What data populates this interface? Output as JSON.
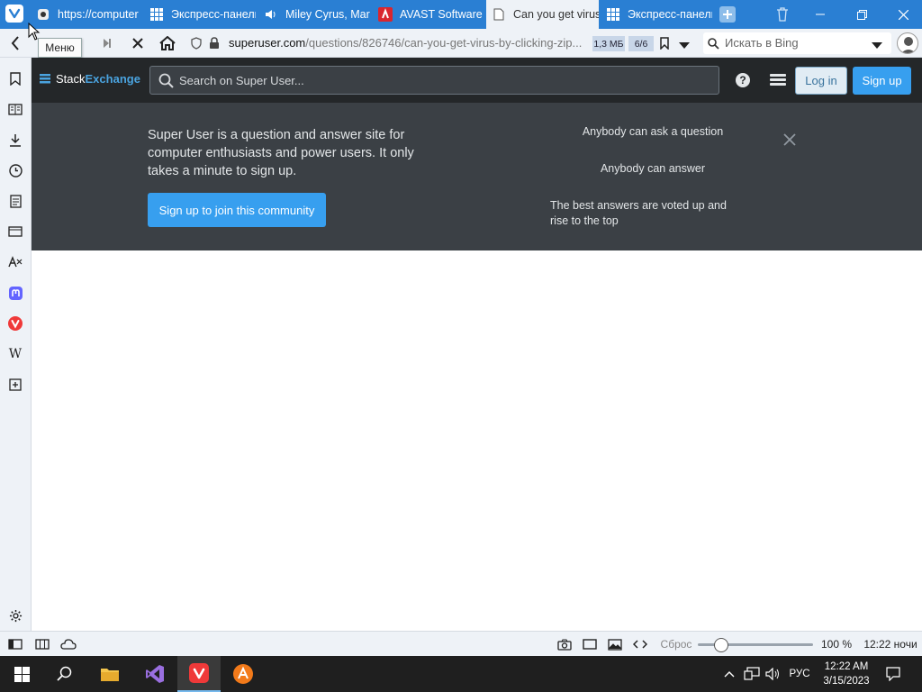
{
  "browser": {
    "tabs": [
      {
        "title": "https://computer",
        "icon": "puzzle-icon"
      },
      {
        "title": "Экспресс-панель",
        "icon": "grid-icon"
      },
      {
        "title": "Miley Cyrus, Mar",
        "icon": "speaker-icon"
      },
      {
        "title": "AVAST Software",
        "icon": "avast-icon"
      },
      {
        "title": "Can you get virus",
        "icon": "page-icon",
        "active": true
      },
      {
        "title": "Экспресс-панель",
        "icon": "grid-icon"
      }
    ],
    "tooltip": "Меню",
    "address": {
      "domain": "superuser.com",
      "path": "/questions/826746/can-you-get-virus-by-clicking-zip..."
    },
    "page_size": "1,3 МБ",
    "page_count": "6/6",
    "search_placeholder": "Искать в Bing"
  },
  "site": {
    "logo_stack": "Stack",
    "logo_exchange": "Exchange",
    "search_placeholder": "Search on Super User...",
    "login": "Log in",
    "signup": "Sign up",
    "banner": {
      "text": "Super User is a question and answer site for computer enthusiasts and power users. It only takes a minute to sign up.",
      "join": "Sign up to join this community",
      "features": [
        "Anybody can ask a question",
        "Anybody can answer",
        "The best answers are voted up and rise to the top"
      ]
    }
  },
  "statusbar": {
    "reset": "Сброс",
    "zoom": "100 %",
    "time": "12:22 ночи",
    "zoom_level_percent": 100
  },
  "taskbar": {
    "lang": "РУС",
    "time": "12:22 AM",
    "date": "3/15/2023"
  },
  "colors": {
    "tabbar": "#2a7fd3",
    "se_header": "#242729",
    "banner": "#3b4045",
    "accent": "#379fef"
  }
}
